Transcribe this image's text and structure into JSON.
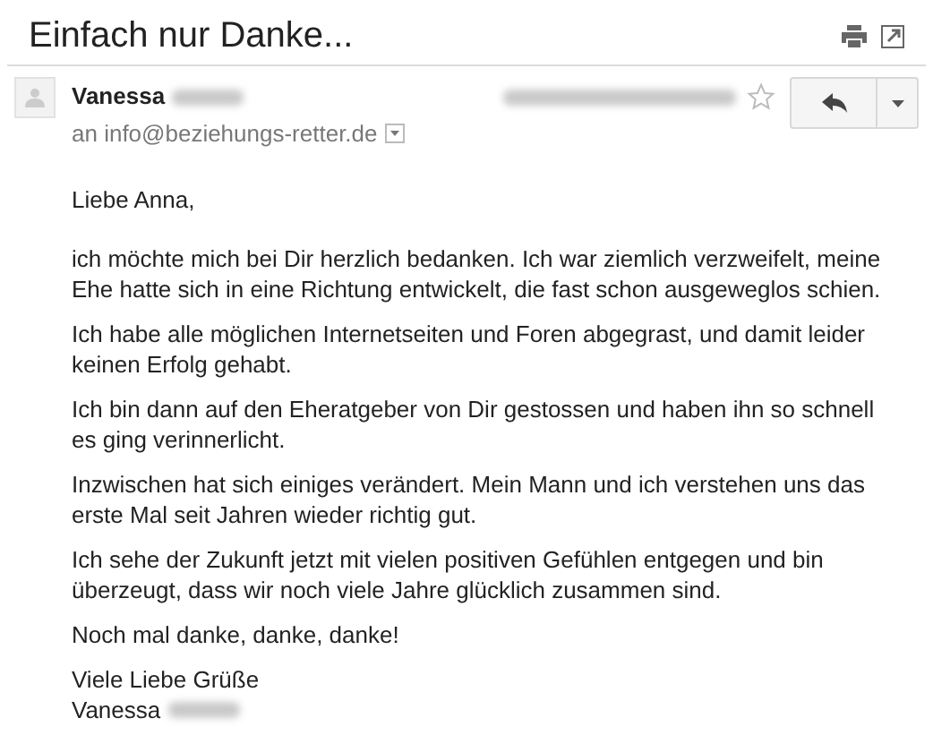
{
  "subject": "Einfach nur Danke...",
  "message": {
    "sender": "Vanessa",
    "recipient": "an info@beziehungs-retter.de",
    "starred": false
  },
  "body": [
    "Liebe Anna,",
    "ich möchte mich bei Dir herzlich bedanken. Ich war ziemlich verzweifelt, meine Ehe hatte sich in eine Richtung entwickelt, die fast schon ausgeweglos schien.",
    "Ich habe alle möglichen Internetseiten und Foren abgegrast, und damit leider keinen Erfolg gehabt.",
    "Ich bin dann auf den Eheratgeber von Dir gestossen und haben ihn so schnell es ging verinnerlicht.",
    "Inzwischen hat sich einiges verändert. Mein Mann und ich verstehen uns das erste Mal seit Jahren wieder richtig gut.",
    "Ich sehe der Zukunft jetzt mit vielen positiven Gefühlen entgegen und bin überzeugt, dass wir noch viele Jahre glücklich zusammen sind.",
    "Noch mal danke, danke, danke!"
  ],
  "signature": {
    "closing": "Viele Liebe Grüße",
    "name": "Vanessa"
  }
}
